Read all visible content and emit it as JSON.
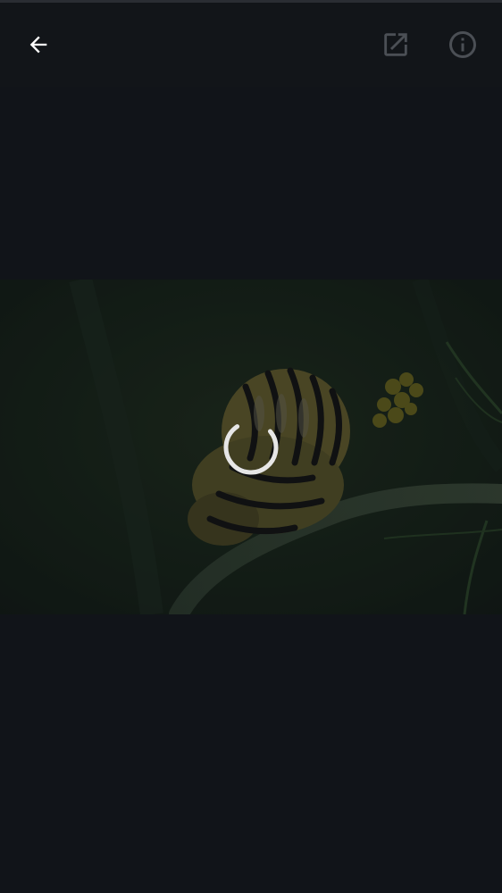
{
  "toolbar": {
    "back": {
      "icon": "arrow-left-icon",
      "color": "#ffffff"
    },
    "open_external": {
      "icon": "open-in-new-icon",
      "color": "#4b4f55"
    },
    "info": {
      "icon": "info-icon",
      "color": "#4b4f55"
    }
  },
  "viewer": {
    "state": "loading",
    "spinner_icon": "loading-spinner-icon",
    "spinner_color": "#e6e6e6"
  },
  "colors": {
    "background": "#111419",
    "top_bar": "#121519"
  }
}
